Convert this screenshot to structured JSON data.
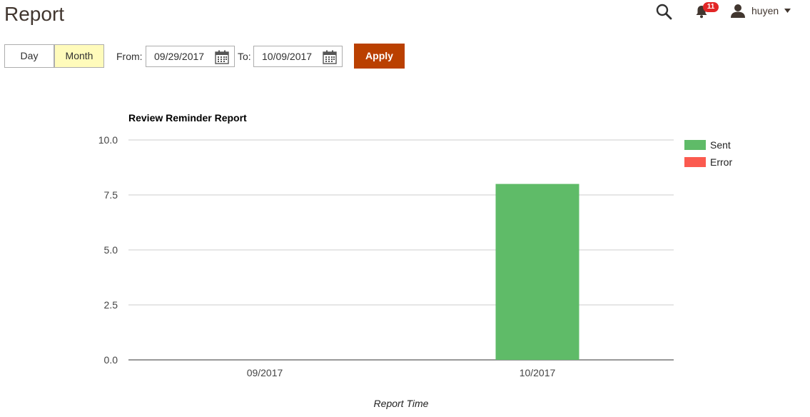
{
  "page": {
    "title": "Report"
  },
  "header": {
    "search_icon": "search-icon",
    "notifications": {
      "icon": "bell-icon",
      "count": "11"
    },
    "user": {
      "icon": "user-icon",
      "name": "huyen"
    }
  },
  "filters": {
    "period_options": [
      {
        "label": "Day",
        "active": false
      },
      {
        "label": "Month",
        "active": true
      }
    ],
    "from_label": "From:",
    "from_value": "09/29/2017",
    "to_label": "To:",
    "to_value": "10/09/2017",
    "apply_label": "Apply",
    "apply_color": "#ba4000",
    "active_toggle_color": "#fffbbb"
  },
  "chart_data": {
    "type": "bar",
    "title": "Review Reminder Report",
    "xlabel": "Report Time",
    "ylabel": "",
    "categories": [
      "09/2017",
      "10/2017"
    ],
    "series": [
      {
        "name": "Sent",
        "color": "#5fbb68",
        "values": [
          0,
          8
        ]
      },
      {
        "name": "Error",
        "color": "#fb5a4f",
        "values": [
          0,
          0
        ]
      }
    ],
    "ylim": [
      0,
      10
    ],
    "yticks": [
      "0.0",
      "2.5",
      "5.0",
      "7.5",
      "10.0"
    ],
    "ytick_values": [
      0,
      2.5,
      5,
      7.5,
      10
    ],
    "grid": true,
    "legend_position": "right"
  }
}
